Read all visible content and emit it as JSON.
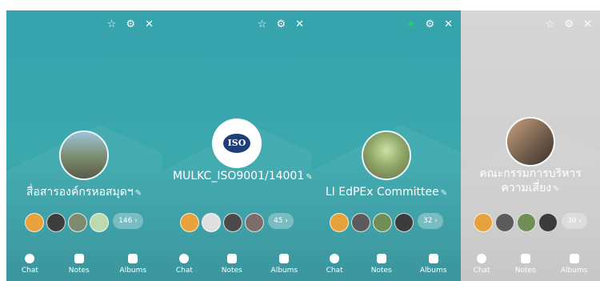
{
  "icons": {
    "star": "☆",
    "star_active": "★",
    "gear": "⚙",
    "close": "✕",
    "edit": "✎"
  },
  "panels": [
    {
      "id": "p1",
      "name": "สื่อสารองค์กรหอสมุดฯ",
      "count": "146 ›",
      "avatar_color": "#7a8b6c"
    },
    {
      "id": "p2",
      "name": "MULKC_ISO9001/14001",
      "count": "45 ›",
      "avatar_text": "ISO"
    },
    {
      "id": "p3",
      "name": "LI EdPEx Committee",
      "count": "32 ›",
      "avatar_color": "#9fb36b"
    },
    {
      "id": "p4",
      "name": "คณะกรรมการบริหารความเสี่ยง",
      "count": "30 ›",
      "avatar_color": "#6d5a4b"
    }
  ],
  "tabs": {
    "chat": "Chat",
    "notes": "Notes",
    "albums": "Albums"
  }
}
